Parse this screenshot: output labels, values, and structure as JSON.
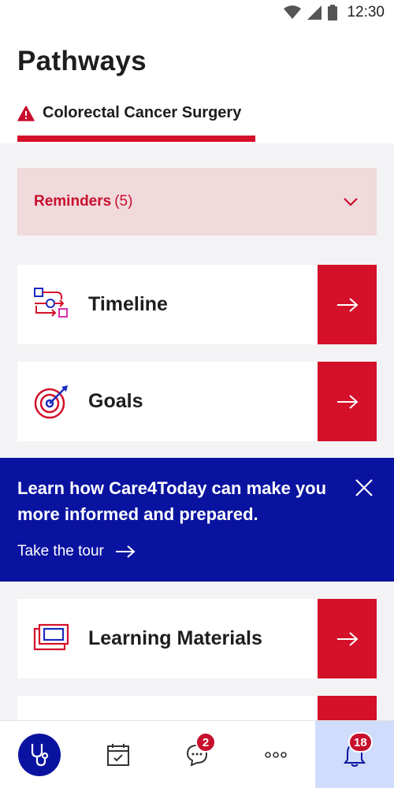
{
  "status_bar": {
    "time": "12:30"
  },
  "header": {
    "title": "Pathways",
    "tab": {
      "label": "Colorectal Cancer Surgery",
      "icon": "warning-icon"
    }
  },
  "reminders": {
    "label": "Reminders",
    "count": "(5)"
  },
  "cards": [
    {
      "title": "Timeline",
      "icon": "timeline-icon"
    },
    {
      "title": "Goals",
      "icon": "target-icon"
    },
    {
      "title": "Learning Materials",
      "icon": "learning-materials-icon"
    }
  ],
  "banner": {
    "text": "Learn how Care4Today can make you more informed and prepared.",
    "link": "Take the tour"
  },
  "nav": {
    "items": [
      {
        "name": "pathways",
        "icon": "stethoscope-icon"
      },
      {
        "name": "calendar",
        "icon": "calendar-icon"
      },
      {
        "name": "messages",
        "icon": "chat-icon",
        "badge": "2"
      },
      {
        "name": "more",
        "icon": "more-icon"
      },
      {
        "name": "notifications",
        "icon": "bell-icon",
        "badge": "18"
      }
    ]
  },
  "colors": {
    "accent": "#d4102a",
    "brand_blue": "#0a13a0",
    "reminders_bg": "#f1dadc"
  }
}
